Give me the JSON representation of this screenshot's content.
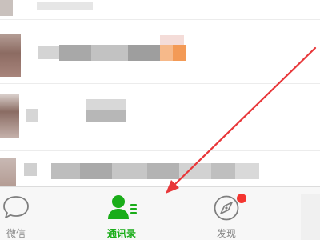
{
  "tabbar": {
    "items": [
      {
        "label": "微信",
        "active": false,
        "icon": "chat-bubble-icon"
      },
      {
        "label": "通讯录",
        "active": true,
        "icon": "contacts-icon"
      },
      {
        "label": "发现",
        "active": false,
        "icon": "compass-icon",
        "badge": true
      }
    ]
  },
  "contacts": {
    "visible_rows": 4,
    "content": "pixelated"
  },
  "annotation": {
    "type": "arrow",
    "color": "#e8373a",
    "points_to": "contacts-tab"
  },
  "colors": {
    "accent": "#1aad19",
    "icon_gray": "#7f7f7f",
    "label_gray": "#888888",
    "badge": "#f43530",
    "arrow": "#e8373a"
  }
}
